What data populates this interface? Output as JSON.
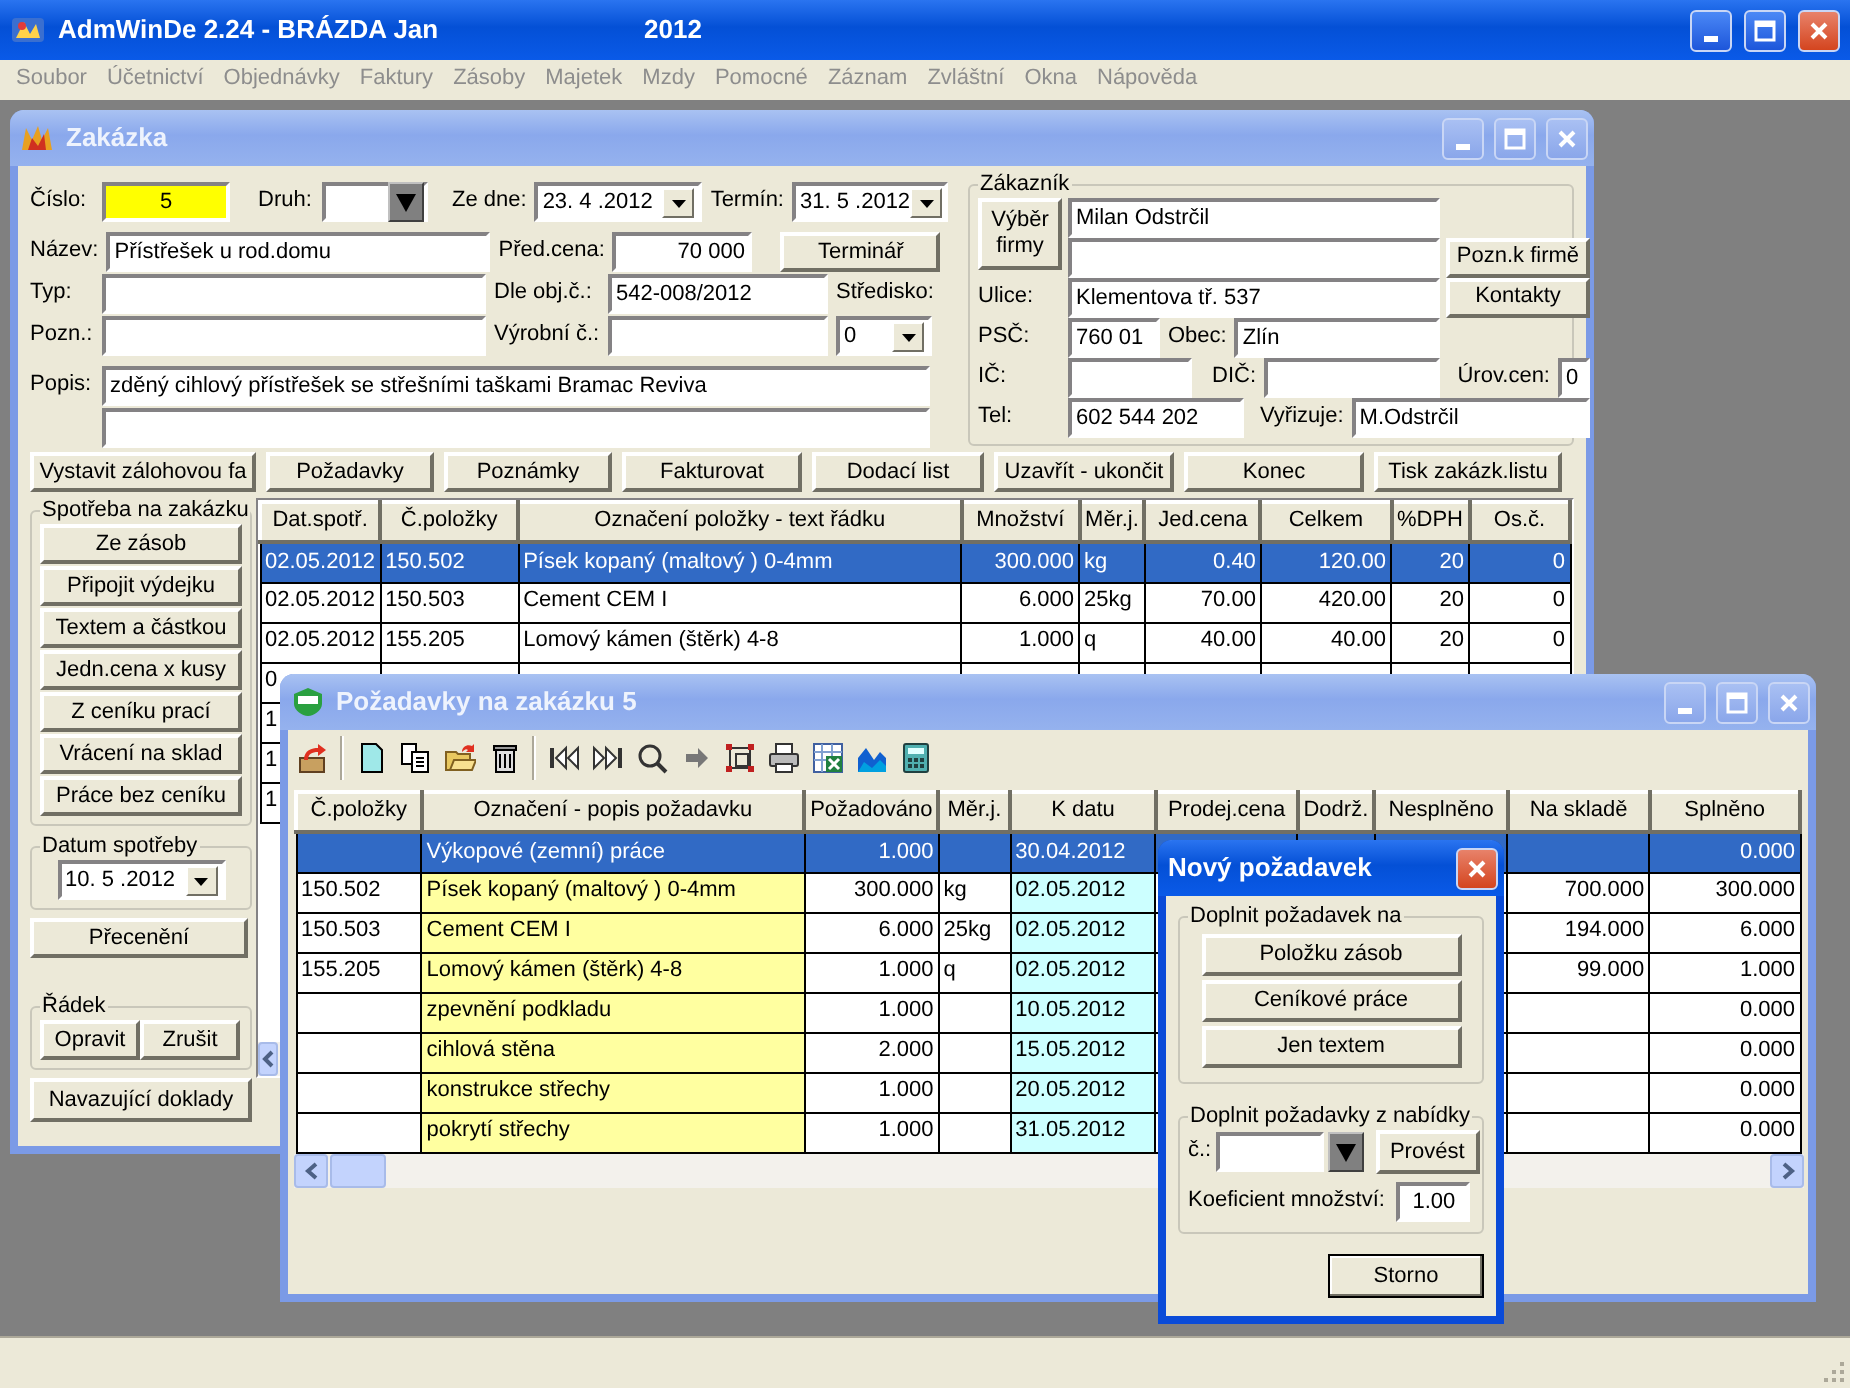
{
  "app": {
    "title": "AdmWinDe 2.24 - BRÁZDA Jan",
    "year": "2012"
  },
  "menu_disabled": true,
  "menu": [
    "Soubor",
    "Účetnictví",
    "Objednávky",
    "Faktury",
    "Zásoby",
    "Majetek",
    "Mzdy",
    "Pomocné",
    "Záznam",
    "Zvláštní",
    "Okna",
    "Nápověda"
  ],
  "order": {
    "title": "Zakázka",
    "active": false,
    "number": {
      "label": "Číslo:",
      "value": "5"
    },
    "kind": {
      "label": "Druh:"
    },
    "date_from": {
      "label": "Ze dne:",
      "value": "23. 4 .2012"
    },
    "deadline": {
      "label": "Termín:",
      "value": "31. 5 .2012"
    },
    "name": {
      "label": "Název:",
      "value": "Přístřešek u rod.domu"
    },
    "type": {
      "label": "Typ:"
    },
    "note": {
      "label": "Pozn.:"
    },
    "price": {
      "label": "Před.cena:",
      "value": "70 000"
    },
    "calendar_button": "Terminář",
    "order_no": {
      "label": "Dle obj.č.:",
      "value": "542-008/2012"
    },
    "serial_no": {
      "label": "Výrobní č.:"
    },
    "center": {
      "label": "Středisko:",
      "value": "0"
    },
    "description": {
      "label": "Popis:",
      "value": "zděný cihlový přístřešek se střešními taškami Bramac Reviva"
    },
    "customer": {
      "title": "Zákazník",
      "select_button": "Výběr firmy",
      "name": "Milan Odstrčil",
      "street_label": "Ulice:",
      "street": "Klementova tř. 537",
      "zip_label": "PSČ:",
      "zip": "760 01",
      "city_label": "Obec:",
      "city": "Zlín",
      "ic_label": "IČ:",
      "dic_label": "DIČ:",
      "price_level_label": "Úrov.cen:",
      "price_level": "0",
      "phone_label": "Tel:",
      "phone": "602 544 202",
      "handler_label": "Vyřizuje:",
      "handler": "M.Odstrčil",
      "note_button": "Pozn.k firmě",
      "contacts_button": "Kontakty"
    },
    "actions": [
      "Vystavit zálohovou fa",
      "Požadavky",
      "Poznámky",
      "Fakturovat",
      "Dodací list",
      "Uzavřít - ukončit",
      "Konec",
      "Tisk zakázk.listu"
    ],
    "consumption": {
      "title": "Spotřeba na zakázku",
      "buttons": [
        "Ze zásob",
        "Připojit výdejku",
        "Textem a částkou",
        "Jedn.cena x kusy",
        "Z ceníku prací",
        "Vrácení na sklad",
        "Práce bez ceníku"
      ]
    },
    "consumption_date": {
      "title": "Datum spotřeby",
      "value": "10. 5 .2012"
    },
    "reprice_button": "Přecenění",
    "row_group": {
      "title": "Řádek",
      "buttons": [
        "Opravit",
        "Zrušit"
      ]
    },
    "related_button": "Navazující doklady",
    "table": {
      "columns": [
        "Dat.spotř.",
        "Č.položky",
        "Označení položky - text řádku",
        "Množství",
        "Měr.j.",
        "Jed.cena",
        "Celkem",
        "%DPH",
        "Os.č."
      ],
      "rows": [
        {
          "selected": true,
          "date": "02.05.2012",
          "item": "150.502",
          "description": "Písek kopaný (maltový ) 0-4mm",
          "quantity": "300.000",
          "unit": "kg",
          "unit_price": "0.40",
          "total": "120.00",
          "vat": "20",
          "person": "0"
        },
        {
          "selected": false,
          "date": "02.05.2012",
          "item": "150.503",
          "description": "Cement CEM I",
          "quantity": "6.000",
          "unit": "25kg",
          "unit_price": "70.00",
          "total": "420.00",
          "vat": "20",
          "person": "0"
        },
        {
          "selected": false,
          "date": "02.05.2012",
          "item": "155.205",
          "description": "Lomový kámen (štěrk) 4-8",
          "quantity": "1.000",
          "unit": "q",
          "unit_price": "40.00",
          "total": "40.00",
          "vat": "20",
          "person": "0"
        },
        {
          "selected": false,
          "date": "0"
        },
        {
          "selected": false,
          "date": "1"
        },
        {
          "selected": false,
          "date": "1"
        },
        {
          "selected": false,
          "date": "1"
        }
      ]
    }
  },
  "requests": {
    "title": "Požadavky na zakázku 5",
    "active": false,
    "columns": [
      "Č.položky",
      "Označení - popis požadavku",
      "Požadováno",
      "Měr.j.",
      "K datu",
      "Prodej.cena",
      "Dodrž.",
      "Nesplněno",
      "Na skladě",
      "Splněno"
    ],
    "rows": [
      {
        "selected": true,
        "description": "Výkopové (zemní) práce",
        "quantity": "1.000",
        "date": "30.04.2012",
        "fulfilled": "0.000"
      },
      {
        "selected": false,
        "item": "150.502",
        "description": "Písek kopaný (maltový ) 0-4mm",
        "quantity": "300.000",
        "unit": "kg",
        "date": "02.05.2012",
        "in_stock": "700.000",
        "fulfilled": "300.000"
      },
      {
        "selected": false,
        "item": "150.503",
        "description": "Cement CEM I",
        "quantity": "6.000",
        "unit": "25kg",
        "date": "02.05.2012",
        "in_stock": "194.000",
        "fulfilled": "6.000"
      },
      {
        "selected": false,
        "item": "155.205",
        "description": "Lomový kámen (štěrk) 4-8",
        "quantity": "1.000",
        "unit": "q",
        "date": "02.05.2012",
        "in_stock": "99.000",
        "fulfilled": "1.000"
      },
      {
        "selected": false,
        "description": "zpevnění podkladu",
        "quantity": "1.000",
        "date": "10.05.2012",
        "fulfilled": "0.000"
      },
      {
        "selected": false,
        "description": "cihlová stěna",
        "quantity": "2.000",
        "date": "15.05.2012",
        "fulfilled": "0.000"
      },
      {
        "selected": false,
        "description": "konstrukce střechy",
        "quantity": "1.000",
        "date": "20.05.2012",
        "fulfilled": "0.000"
      },
      {
        "selected": false,
        "description": "pokrytí střechy",
        "quantity": "1.000",
        "date": "31.05.2012",
        "fulfilled": "0.000"
      }
    ]
  },
  "dialog": {
    "title": "Nový požadavek",
    "active": true,
    "group1_title": "Doplnit požadavek na",
    "buttons": [
      "Položku zásob",
      "Ceníkové práce",
      "Jen textem"
    ],
    "group2_title": "Doplnit požadavky z nabídky",
    "number_label": "č.:",
    "run_button": "Provést",
    "coefficient_label": "Koeficient množství:",
    "coefficient": "1.00",
    "cancel_button": "Storno"
  }
}
